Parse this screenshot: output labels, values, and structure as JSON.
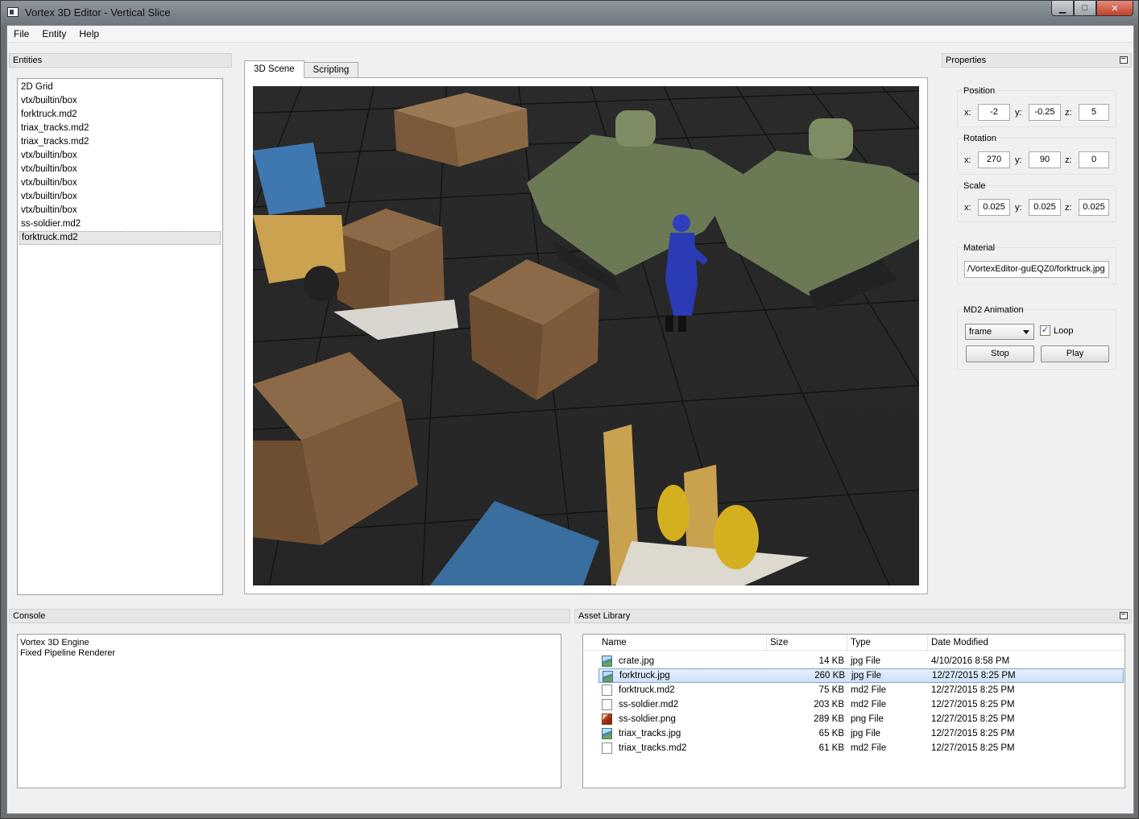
{
  "window": {
    "title": "Vortex 3D Editor - Vertical Slice",
    "minimize": "▁",
    "maximize": "□",
    "close": "✕"
  },
  "menu": [
    "File",
    "Entity",
    "Help"
  ],
  "entities": {
    "title": "Entities",
    "items": [
      "2D Grid",
      "vtx/builtin/box",
      "forktruck.md2",
      "triax_tracks.md2",
      "triax_tracks.md2",
      "vtx/builtin/box",
      "vtx/builtin/box",
      "vtx/builtin/box",
      "vtx/builtin/box",
      "vtx/builtin/box",
      "ss-soldier.md2",
      "forktruck.md2"
    ],
    "selected_index": 11
  },
  "tabs": [
    "3D Scene",
    "Scripting"
  ],
  "properties": {
    "title": "Properties",
    "position": {
      "label": "Position",
      "x": "-2",
      "y": "-0.25",
      "z": "5"
    },
    "rotation": {
      "label": "Rotation",
      "x": "270",
      "y": "90",
      "z": "0"
    },
    "scale": {
      "label": "Scale",
      "x": "0.025",
      "y": "0.025",
      "z": "0.025"
    },
    "axes": {
      "x": "x:",
      "y": "y:",
      "z": "z:"
    },
    "material": {
      "label": "Material",
      "value": "/VortexEditor-guEQZ0/forktruck.jpg"
    },
    "animation": {
      "label": "MD2 Animation",
      "selected": "frame",
      "loop_label": "Loop",
      "loop_checked": "✓",
      "stop": "Stop",
      "play": "Play"
    }
  },
  "console": {
    "title": "Console",
    "lines": [
      "Vortex 3D Engine",
      "Fixed Pipeline Renderer"
    ]
  },
  "assets": {
    "title": "Asset Library",
    "columns": [
      "Name",
      "Size",
      "Type",
      "Date Modified"
    ],
    "rows": [
      {
        "name": "crate.jpg",
        "size": "14 KB",
        "type": "jpg File",
        "date": "4/10/2016 8:58 PM",
        "icon": "image-file-icon"
      },
      {
        "name": "forktruck.jpg",
        "size": "260 KB",
        "type": "jpg File",
        "date": "12/27/2015 8:25 PM",
        "icon": "image-file-icon"
      },
      {
        "name": "forktruck.md2",
        "size": "75 KB",
        "type": "md2 File",
        "date": "12/27/2015 8:25 PM",
        "icon": "blank-file-icon"
      },
      {
        "name": "ss-soldier.md2",
        "size": "203 KB",
        "type": "md2 File",
        "date": "12/27/2015 8:25 PM",
        "icon": "blank-file-icon"
      },
      {
        "name": "ss-soldier.png",
        "size": "289 KB",
        "type": "png File",
        "date": "12/27/2015 8:25 PM",
        "icon": "png-file-icon"
      },
      {
        "name": "triax_tracks.jpg",
        "size": "65 KB",
        "type": "jpg File",
        "date": "12/27/2015 8:25 PM",
        "icon": "image-file-icon"
      },
      {
        "name": "triax_tracks.md2",
        "size": "61 KB",
        "type": "md2 File",
        "date": "12/27/2015 8:25 PM",
        "icon": "blank-file-icon"
      }
    ],
    "selected_index": 1
  },
  "colors": {
    "viewport_bg": "#262626",
    "selection_blue": "#cde1f7",
    "title_bar": "#6f767e"
  }
}
